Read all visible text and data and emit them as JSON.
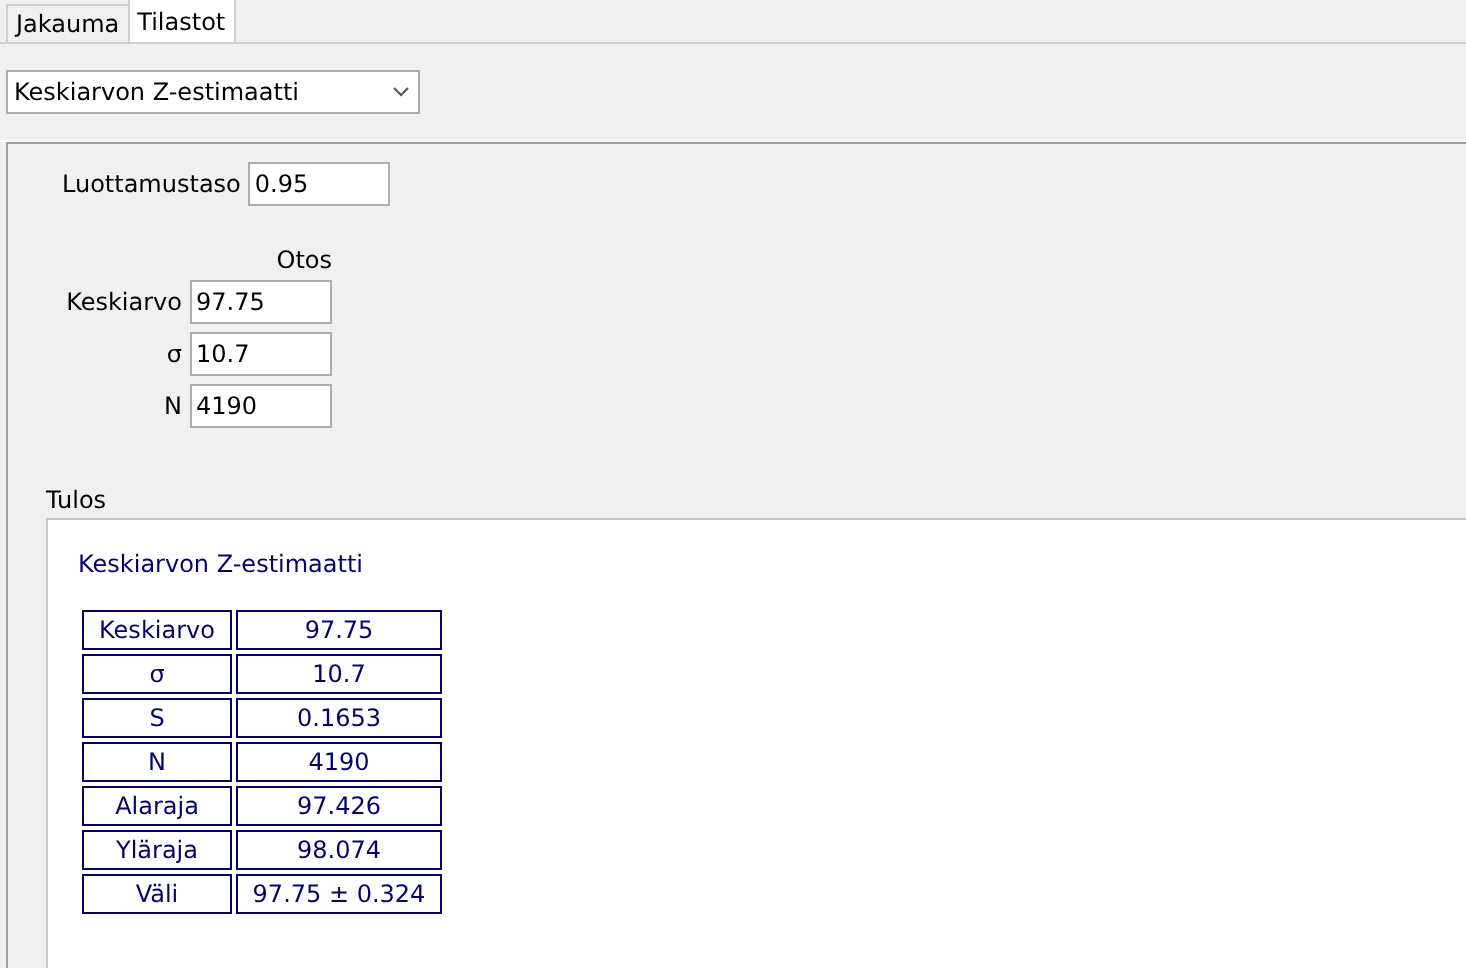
{
  "tabs": [
    {
      "label": "Jakauma",
      "selected": false
    },
    {
      "label": "Tilastot",
      "selected": true
    }
  ],
  "procedure_dropdown": {
    "value": "Keskiarvon Z-estimaatti"
  },
  "confidence": {
    "label": "Luottamustaso",
    "value": "0.95"
  },
  "sample": {
    "heading": "Otos",
    "fields": [
      {
        "label": "Keskiarvo",
        "value": "97.75"
      },
      {
        "label": "σ",
        "value": "10.7"
      },
      {
        "label": "N",
        "value": "4190"
      }
    ]
  },
  "result": {
    "label": "Tulos",
    "title": "Keskiarvon Z-estimaatti",
    "rows": [
      {
        "name": "Keskiarvo",
        "value": "97.75"
      },
      {
        "name": "σ",
        "value": "10.7"
      },
      {
        "name": "S",
        "value": "0.1653"
      },
      {
        "name": "N",
        "value": "4190"
      },
      {
        "name": "Alaraja",
        "value": "97.426"
      },
      {
        "name": "Yläraja",
        "value": "98.074"
      },
      {
        "name": "Väli",
        "value": "97.75 ± 0.324"
      }
    ]
  }
}
